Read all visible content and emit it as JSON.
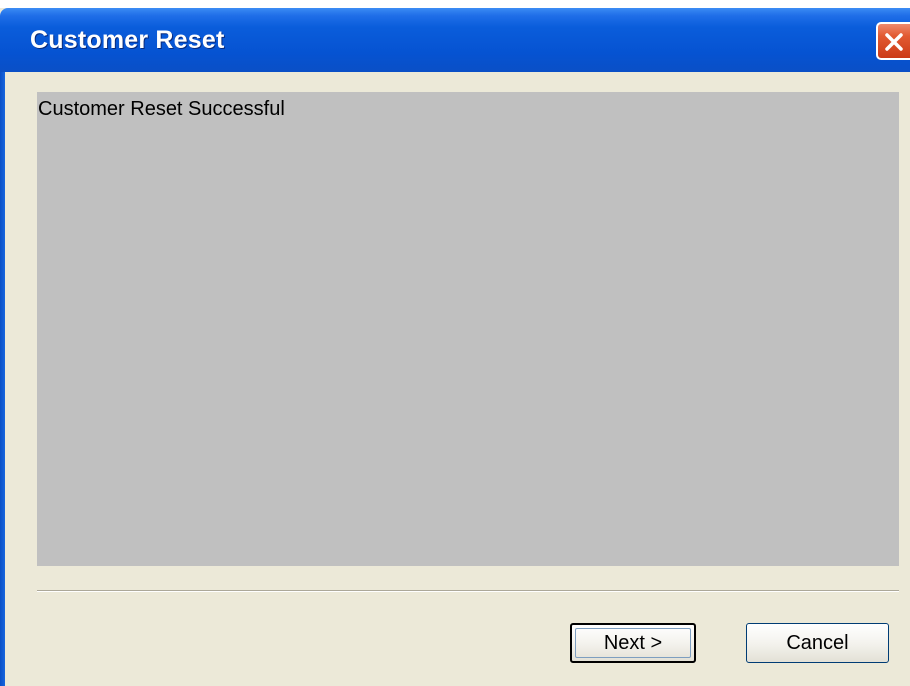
{
  "window": {
    "title": "Customer Reset"
  },
  "content": {
    "message": "Customer Reset Successful"
  },
  "buttons": {
    "next_label": "Next >",
    "cancel_label": "Cancel"
  },
  "colors": {
    "titlebar": "#0653d2",
    "dialog_background": "#ece9d8",
    "content_background": "#c0c0c0",
    "close_button": "#e25a32"
  },
  "icons": {
    "close": "close-icon"
  }
}
